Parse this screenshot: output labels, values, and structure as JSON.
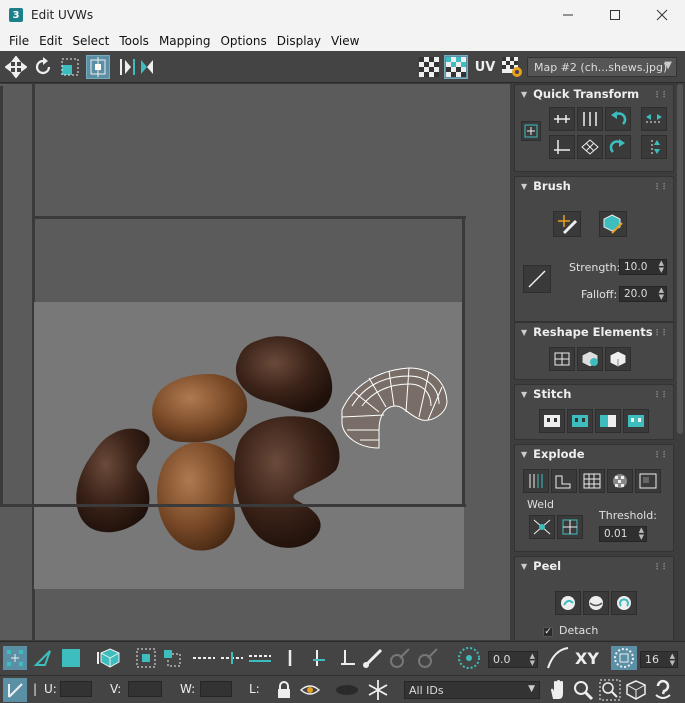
{
  "window": {
    "title": "Edit UVWs",
    "app_icon": "3",
    "controls": [
      "minimize-icon",
      "maximize-icon",
      "close-icon"
    ]
  },
  "menu": [
    "File",
    "Edit",
    "Select",
    "Tools",
    "Mapping",
    "Options",
    "Display",
    "View"
  ],
  "toolbar_top": {
    "uv_label": "UV",
    "map_select": "Map #2 (ch...shews.jpg)"
  },
  "panel": {
    "quick_transform": {
      "title": "Quick Transform"
    },
    "brush": {
      "title": "Brush",
      "strength_label": "Strength:",
      "strength_value": "10.0",
      "falloff_label": "Falloff:",
      "falloff_value": "20.0"
    },
    "reshape": {
      "title": "Reshape Elements"
    },
    "stitch": {
      "title": "Stitch"
    },
    "explode": {
      "title": "Explode",
      "weld_label": "Weld",
      "threshold_label": "Threshold:",
      "threshold_value": "0.01"
    },
    "peel": {
      "title": "Peel",
      "detach_label": "Detach",
      "detach_checked": true
    }
  },
  "bottom1": {
    "angle_value": "0.0",
    "xy_label": "XY",
    "grid_value": "16"
  },
  "bottom2": {
    "u_label": "U:",
    "v_label": "V:",
    "w_label": "W:",
    "l_label": "L:",
    "ids_dropdown": "All IDs"
  },
  "colors": {
    "accent": "#3dbdbd",
    "viewport_bg": "#5b5b5b",
    "panel_bg": "#3d3d3d"
  }
}
